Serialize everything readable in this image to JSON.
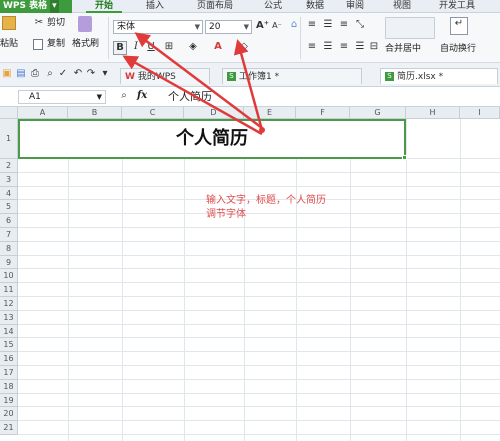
{
  "app": {
    "name": "WPS 表格"
  },
  "menu": [
    "开始",
    "插入",
    "页面布局",
    "公式",
    "数据",
    "审阅",
    "视图",
    "开发工具"
  ],
  "clipboard": {
    "cut": "剪切",
    "paste": "粘贴",
    "copy": "复制",
    "format_painter": "格式刷"
  },
  "font": {
    "name": "宋体",
    "size": "20",
    "bold": "B",
    "italic": "I",
    "underline": "U"
  },
  "alignment": {
    "merge_center": "合并居中",
    "wrap": "自动换行"
  },
  "doc_tabs": [
    "我的WPS",
    "工作簿1 *",
    "简历.xlsx *"
  ],
  "formula_bar": {
    "name_box": "A1",
    "fx": "fx",
    "value": "个人简历"
  },
  "columns": [
    "A",
    "B",
    "C",
    "D",
    "E",
    "F",
    "G",
    "H",
    "I"
  ],
  "rows": [
    "1",
    "2",
    "3",
    "4",
    "5",
    "6",
    "7",
    "8",
    "9",
    "10",
    "11",
    "12",
    "13",
    "14",
    "15",
    "16",
    "17",
    "18",
    "19",
    "20",
    "21"
  ],
  "cell_a1": "个人简历",
  "annotation": {
    "line1": "输入文字，标题，个人简历",
    "line2": "调节字体"
  },
  "colors": {
    "accent": "#3d9a3d",
    "annotation": "#e04c4c"
  }
}
